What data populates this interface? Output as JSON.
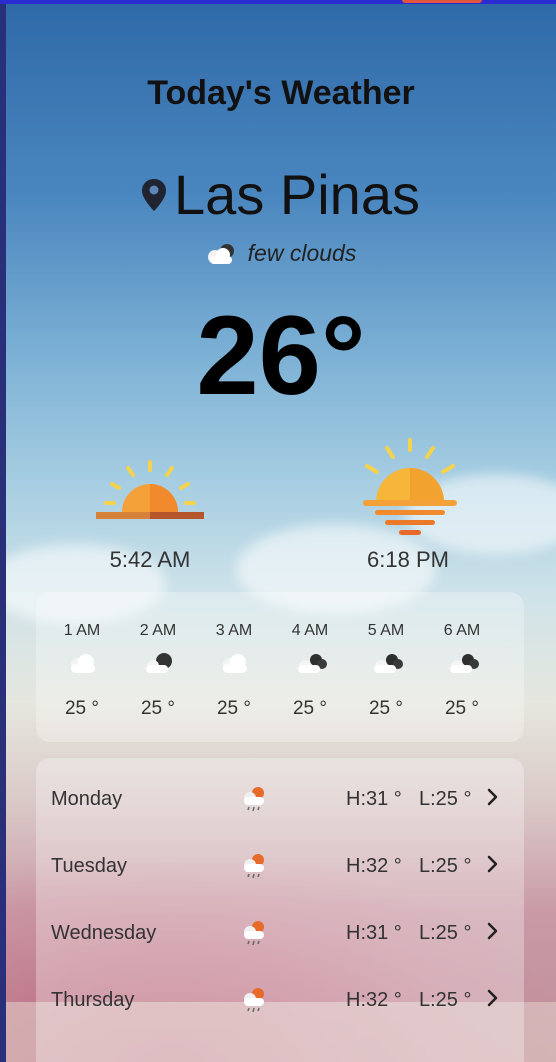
{
  "header": {
    "title": "Today's Weather"
  },
  "location": {
    "city": "Las Pinas",
    "icon": "location-pin-icon"
  },
  "current": {
    "condition": "few clouds",
    "condition_icon": "few-clouds-icon",
    "temperature": "26°"
  },
  "sun": {
    "sunrise": "5:42 AM",
    "sunset": "6:18 PM"
  },
  "hourly": [
    {
      "time": "1 AM",
      "icon": "cloud-icon",
      "temp": "25 °"
    },
    {
      "time": "2 AM",
      "icon": "night-cloud-icon",
      "temp": "25 °"
    },
    {
      "time": "3 AM",
      "icon": "cloud-icon",
      "temp": "25 °"
    },
    {
      "time": "4 AM",
      "icon": "broken-clouds-icon",
      "temp": "25 °"
    },
    {
      "time": "5 AM",
      "icon": "broken-clouds-icon",
      "temp": "25 °"
    },
    {
      "time": "6 AM",
      "icon": "broken-clouds-icon",
      "temp": "25 °"
    }
  ],
  "daily": [
    {
      "day": "Monday",
      "icon": "sun-rain-icon",
      "high": "H:31 °",
      "low": "L:25 °"
    },
    {
      "day": "Tuesday",
      "icon": "sun-rain-icon",
      "high": "H:32 °",
      "low": "L:25 °"
    },
    {
      "day": "Wednesday",
      "icon": "sun-rain-icon",
      "high": "H:31 °",
      "low": "L:25 °"
    },
    {
      "day": "Thursday",
      "icon": "sun-rain-icon",
      "high": "H:32 °",
      "low": "L:25 °"
    }
  ],
  "colors": {
    "accent_orange": "#f5a13a",
    "sun_yellow": "#f7d24b",
    "horizon_brown": "#b5562a"
  }
}
